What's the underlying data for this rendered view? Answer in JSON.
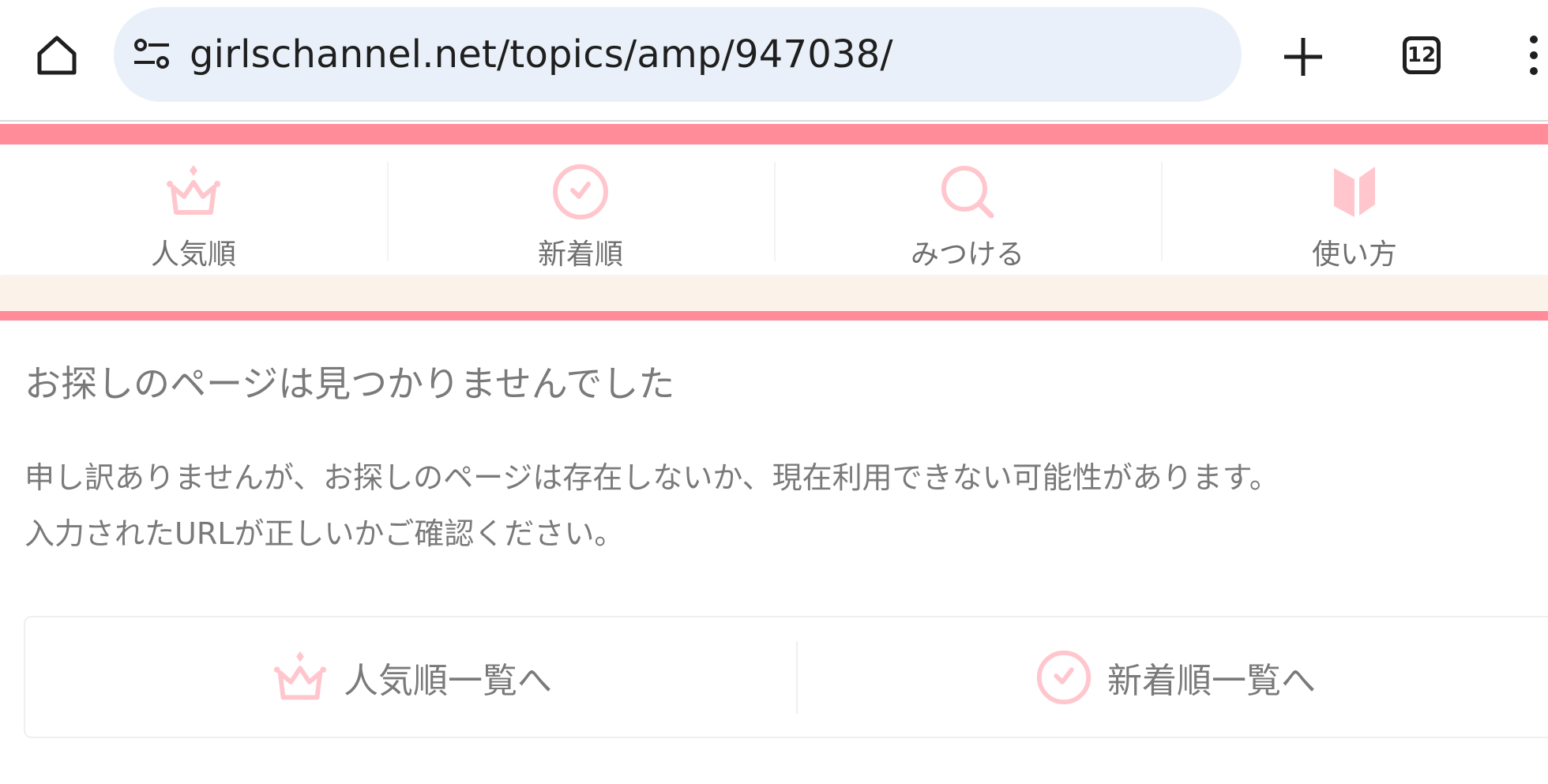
{
  "browser": {
    "url": "girlschannel.net/topics/amp/947038/",
    "tab_count": "12",
    "icons": {
      "home": "home-icon",
      "site_settings": "tune-icon",
      "new_tab": "plus-icon",
      "tabs": "tab-switcher-icon",
      "menu": "more-vert-icon"
    }
  },
  "nav": {
    "items": [
      {
        "label": "人気順",
        "icon": "crown-icon"
      },
      {
        "label": "新着順",
        "icon": "clock-icon"
      },
      {
        "label": "みつける",
        "icon": "search-icon"
      },
      {
        "label": "使い方",
        "icon": "book-icon"
      }
    ]
  },
  "content": {
    "title": "お探しのページは見つかりませんでした",
    "message_line1": "申し訳ありませんが、お探しのページは存在しないか、現在利用できない可能性があります。",
    "message_line2": "入力されたURLが正しいかご確認ください。"
  },
  "buttons": {
    "popular": {
      "label": "人気順一覧へ",
      "icon": "crown-icon"
    },
    "newest": {
      "label": "新着順一覧へ",
      "icon": "clock-icon"
    }
  },
  "colors": {
    "accent_pink": "#ff8c98",
    "icon_pink": "#ffc7cd",
    "cream": "#fbf2ea",
    "text_gray": "#7a7a7a",
    "urlbar_bg": "#eaf0f9"
  }
}
